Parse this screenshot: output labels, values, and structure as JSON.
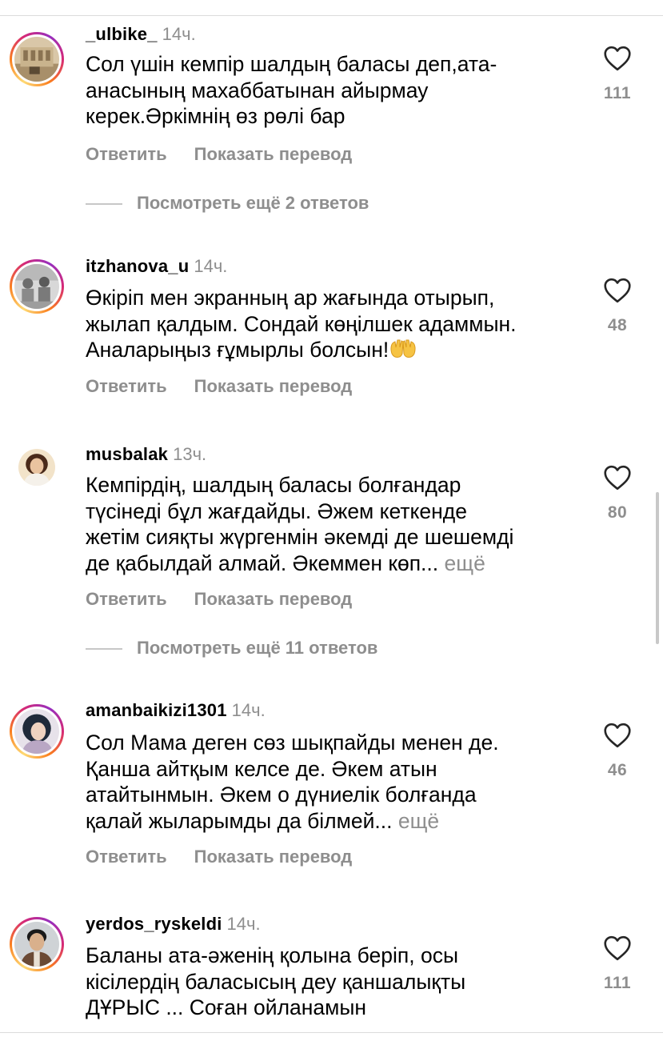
{
  "actions": {
    "reply_label": "Ответить",
    "translate_label": "Показать перевод"
  },
  "comments": [
    {
      "username": "_ulbike_",
      "time": "14ч.",
      "avatar": "photo-building-icon",
      "likes": "111",
      "lines": [
        "Сол үшін кемпір шалдың баласы деп,ата-",
        "анасының махаббатынан айырмау",
        "керек.Әркімнің өз рөлі бар"
      ]
    },
    {
      "username": "itzhanova_u",
      "time": "14ч.",
      "avatar": "photo-group-icon",
      "likes": "48",
      "lines": [
        "Өкіріп мен экранның ар жағында отырып,",
        "жылап қалдым. Сондай көңілшек адаммын.",
        "Аналарыңыз ғұмырлы болсын!"
      ],
      "emoji": "open-hands-emoji"
    },
    {
      "username": "musbalak",
      "time": "13ч.",
      "avatar": "photo-woman-icon",
      "likes": "80",
      "lines": [
        "Кемпірдің, шалдың баласы болғандар",
        "түсінеді бұл жағдайды. Әжем кеткенде",
        "жетім сияқты жүргенмін әкемді де шешемді",
        "де қабылдай алмай. Әкеммен көп..."
      ],
      "more": "ещё"
    },
    {
      "username": "amanbaikizi1301",
      "time": "14ч.",
      "avatar": "photo-woman-icon",
      "likes": "46",
      "lines": [
        "Сол Мама деген сөз шықпайды менен де.",
        "Қанша айтқым келсе де. Әкем атын",
        "атайтынмын. Әкем о дүниелік болғанда",
        "қалай жыларымды да білмей..."
      ],
      "more": "ещё"
    },
    {
      "username": "yerdos_ryskeldi",
      "time": "14ч.",
      "avatar": "photo-man-icon",
      "likes": "111",
      "lines": [
        "Баланы ата-әженің қолына беріп, осы",
        "кісілердің баласысың деу қаншалықты",
        "ДҰРЫС ... Соған ойланамын"
      ]
    }
  ],
  "view_replies": [
    {
      "label": "Посмотреть ещё 2 ответов"
    },
    {
      "label": "Посмотреть ещё 11 ответов"
    }
  ],
  "colors": {
    "secondary_text": "#8e8e8e",
    "story_ring": "#d62976"
  }
}
